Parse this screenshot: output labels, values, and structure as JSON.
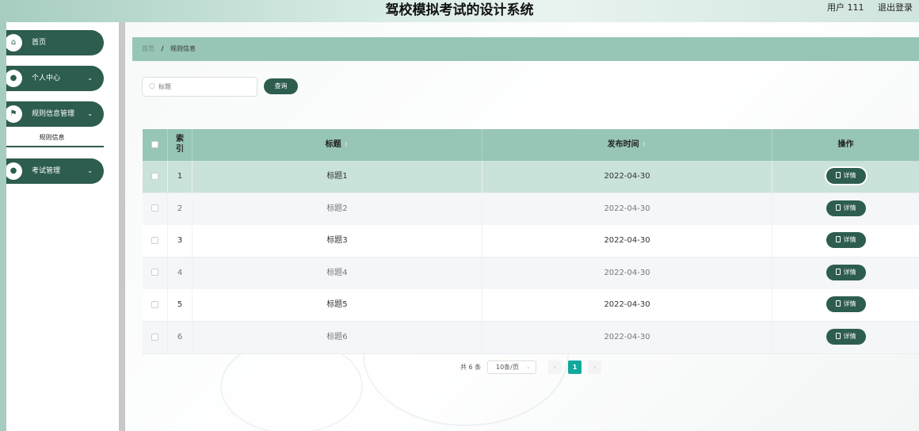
{
  "header": {
    "title": "驾校模拟考试的设计系统",
    "user_label": "用户 111",
    "logout_label": "退出登录"
  },
  "sidebar": {
    "items": [
      {
        "label": "首页",
        "icon": "home-icon"
      },
      {
        "label": "个人中心",
        "icon": "user-icon"
      },
      {
        "label": "规则信息管理",
        "icon": "flag-icon"
      },
      {
        "label": "考试管理",
        "icon": "user-icon"
      }
    ],
    "sub_item": "规则信息"
  },
  "breadcrumb": {
    "home": "首页",
    "separator": "/",
    "current": "规则信息"
  },
  "search": {
    "placeholder": "标题",
    "value": "",
    "button_label": "查询"
  },
  "table": {
    "columns": {
      "index": "索\n引",
      "title": "标题",
      "time": "发布时间",
      "ops": "操作"
    },
    "rows": [
      {
        "index": "1",
        "title": "标题1",
        "time": "2022-04-30",
        "action": "详情"
      },
      {
        "index": "2",
        "title": "标题2",
        "time": "2022-04-30",
        "action": "详情"
      },
      {
        "index": "3",
        "title": "标题3",
        "time": "2022-04-30",
        "action": "详情"
      },
      {
        "index": "4",
        "title": "标题4",
        "time": "2022-04-30",
        "action": "详情"
      },
      {
        "index": "5",
        "title": "标题5",
        "time": "2022-04-30",
        "action": "详情"
      },
      {
        "index": "6",
        "title": "标题6",
        "time": "2022-04-30",
        "action": "详情"
      }
    ]
  },
  "pagination": {
    "total_label": "共 6 条",
    "page_size": "10条/页",
    "current_page": "1",
    "prev": "‹",
    "next": "›"
  },
  "colors": {
    "primary": "#2d5d4f",
    "header_bg": "#97c5b6",
    "page_active": "#13a89e"
  }
}
